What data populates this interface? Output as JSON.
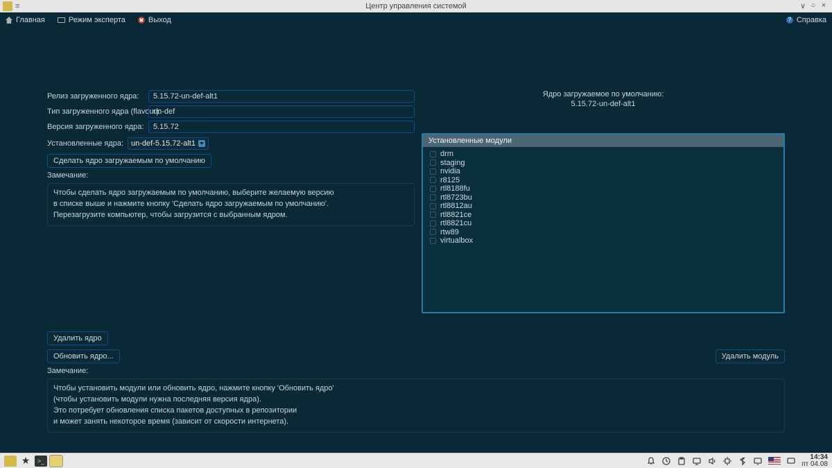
{
  "titlebar": {
    "title": "Центр управления системой"
  },
  "menu": {
    "home": "Главная",
    "expert": "Режим эксперта",
    "exit": "Выход",
    "help": "Справка"
  },
  "fields": {
    "release_label": "Релиз загруженного ядра:",
    "release_value": "5.15.72-un-def-alt1",
    "flavour_label": "Тип загруженного ядра (flavour):",
    "flavour_value": "un-def",
    "version_label": "Версия загруженного ядра:",
    "version_value": "5.15.72"
  },
  "installed": {
    "label": "Установленные ядра:",
    "selected": "un-def-5.15.72-alt1"
  },
  "buttons": {
    "make_default": "Сделать ядро загружаемым по умолчанию",
    "delete_kernel": "Удалить ядро",
    "update_kernel": "Обновить ядро...",
    "delete_module": "Удалить модуль"
  },
  "notes": {
    "label": "Замечание:",
    "top1": "Чтобы сделать ядро загружаемым по умолчанию, выберите желаемую версию",
    "top2": "в списке выше и нажмите кнопку 'Сделать ядро загружаемым по умолчанию'.",
    "top3": "Перезагрузите компьютер, чтобы загрузится с выбранным ядром.",
    "bot1": "Чтобы установить модули или обновить ядро, нажмите кнопку 'Обновить ядро'",
    "bot2": "(чтобы установить модули нужна последняя версия ядра).",
    "bot3": "Это потребует обновления списка пакетов доступных в репозитории",
    "bot4": "и может занять некоторое время (зависит от скорости интернета)."
  },
  "default_kernel": {
    "title": "Ядро загружаемое по умолчанию:",
    "value": "5.15.72-un-def-alt1"
  },
  "modules": {
    "header": "Установленные модули",
    "items": [
      "drm",
      "staging",
      "nvidia",
      "r8125",
      "rtl8188fu",
      "rtl8723bu",
      "rtl8812au",
      "rtl8821ce",
      "rtl8821cu",
      "rtw89",
      "virtualbox"
    ]
  },
  "clock": {
    "time": "14:34",
    "date": "пт 04.08"
  }
}
